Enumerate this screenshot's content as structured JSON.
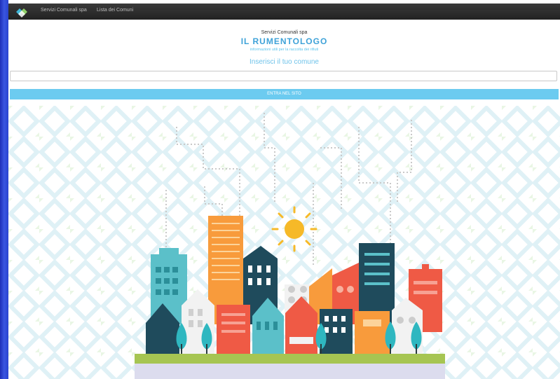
{
  "navbar": {
    "logo_icon": "diamond-logo-icon",
    "links": [
      "Servizi Comunali spa",
      "Lista dei Comuni"
    ]
  },
  "header": {
    "company": "Servizi Comunali spa",
    "title": "IL RUMENTOLOGO",
    "subtitle": "informazioni utili per la raccolta dei rifiuti"
  },
  "search": {
    "prompt": "Inserisci il tuo comune",
    "value": "",
    "button_label": "ENTRA NEL SITO"
  },
  "colors": {
    "navbar": "#2b2b2b",
    "accent": "#6ccbf0",
    "title": "#3ea2d8"
  }
}
